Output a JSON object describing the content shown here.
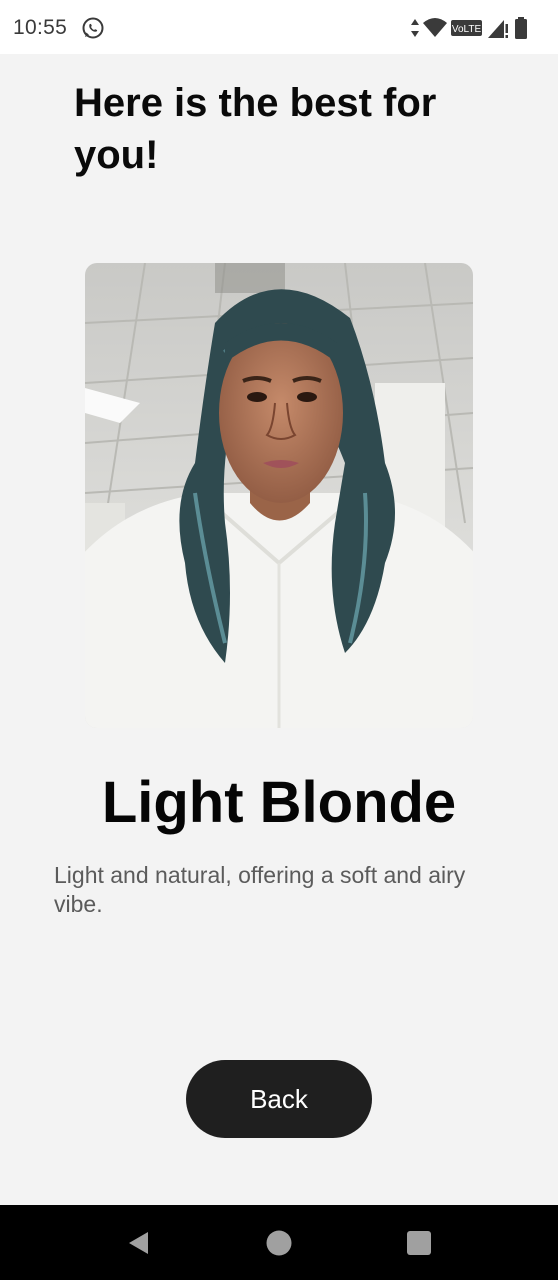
{
  "status_bar": {
    "time": "10:55",
    "icons": [
      "whatsapp-icon",
      "data-arrows-icon",
      "wifi-icon",
      "volte-icon",
      "signal-icon",
      "battery-icon"
    ],
    "volte_label": "VoLTE"
  },
  "main": {
    "headline": "Here is the best for you!",
    "photo_icon": "selfie-photo",
    "result_title": "Light Blonde",
    "result_description": "Light and natural, offering a soft and airy vibe.",
    "back_label": "Back"
  },
  "nav_bar": {
    "icons": [
      "back-triangle-icon",
      "home-circle-icon",
      "recents-square-icon"
    ]
  },
  "colors": {
    "background": "#f3f3f3",
    "button": "#1f1f1f",
    "nav_bar": "#000000",
    "text_primary": "#0a0a0a",
    "text_secondary": "#5b5b5b"
  }
}
